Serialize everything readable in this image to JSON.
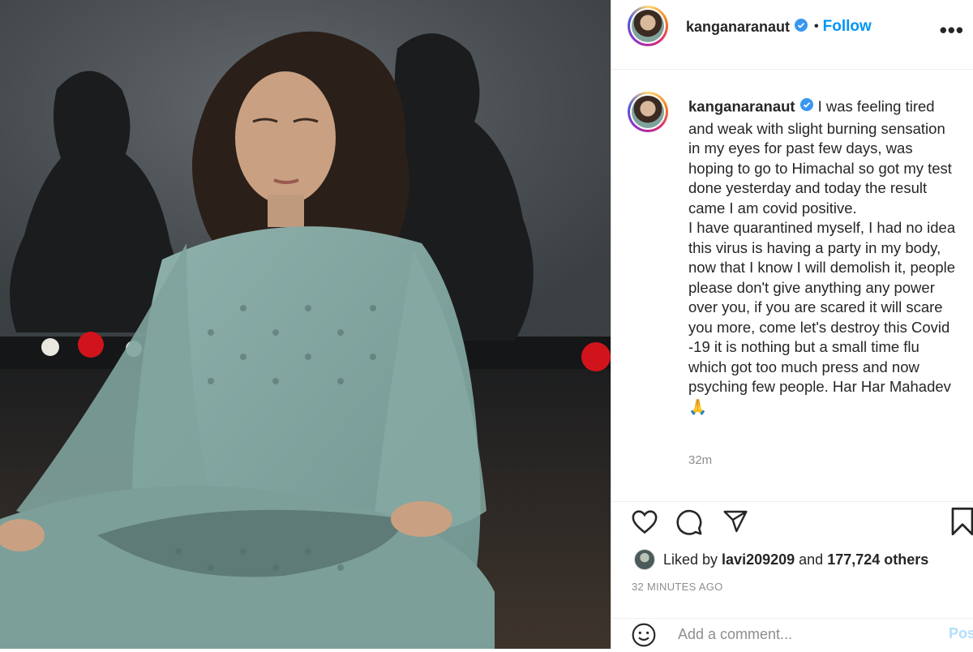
{
  "post": {
    "image_alt": "Woman meditating in cross-legged pose wearing sage green salwar suit in front of dark statues",
    "image_icon": "photo"
  },
  "header": {
    "username": "kanganaranaut",
    "verified_icon": "verified-badge-icon",
    "separator": "•",
    "follow_label": "Follow",
    "more_icon": "more-options-icon",
    "more_label": "•••"
  },
  "caption": {
    "username": "kanganaranaut",
    "text": "I was feeling tired and weak with slight burning sensation in my eyes for past few days, was hoping to go to Himachal so got my test done yesterday and today the result came I am covid positive.\nI have quarantined myself, I had no idea this virus is having a party in my body, now that I know I will demolish it, people please don't give anything any power over you, if you are scared it will scare you more, come let's destroy this Covid -19 it is nothing but a small time flu which got too much press and now psyching few people. Har Har Mahadev 🙏",
    "time": "32m"
  },
  "actions": {
    "like_icon": "heart-icon",
    "comment_icon": "comment-icon",
    "share_icon": "paper-plane-icon",
    "save_icon": "bookmark-icon"
  },
  "likes": {
    "prefix": "Liked by ",
    "user": "lavi209209",
    "middle": " and ",
    "count": "177,724 others"
  },
  "posted_ago": "32 MINUTES AGO",
  "comment": {
    "emoji_icon": "smiley-icon",
    "placeholder": "Add a comment...",
    "post_label": "Post"
  },
  "colors": {
    "link": "#0095f6",
    "muted": "#8e8e8e",
    "text": "#262626",
    "post_disabled": "#b2dffc"
  }
}
